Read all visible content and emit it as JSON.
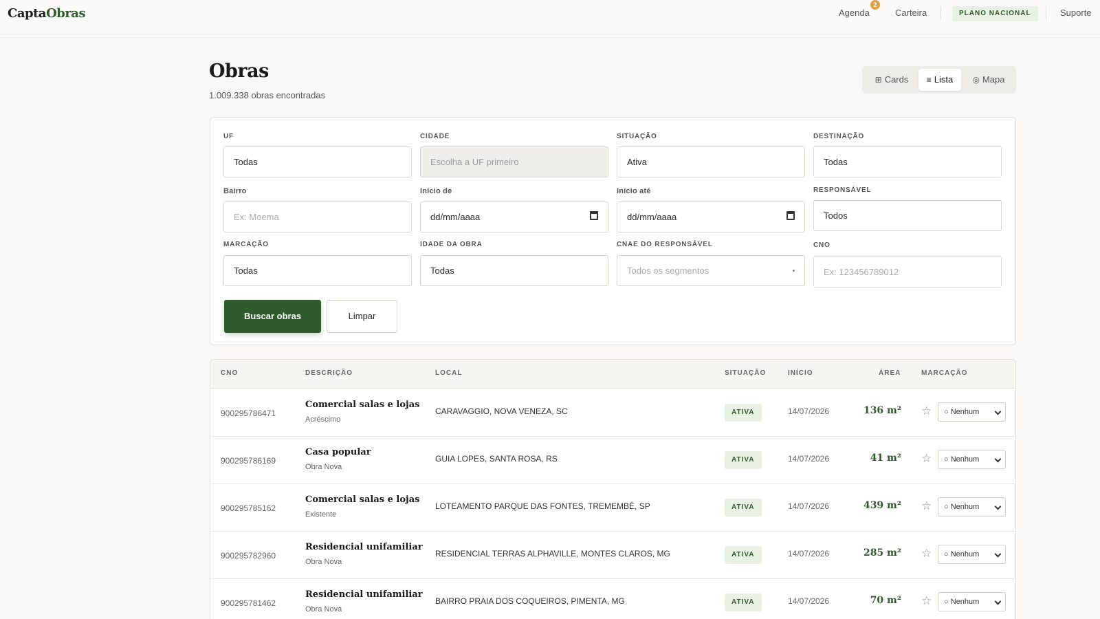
{
  "brand": {
    "part1": "Capta",
    "part2": "Obras",
    "accent_color": "#2f5a2b"
  },
  "nav": {
    "agenda": "Agenda",
    "agenda_badge": "2",
    "carteira": "Carteira",
    "plan": "PLANO NACIONAL",
    "suporte": "Suporte"
  },
  "page": {
    "title": "Obras",
    "subtitle": "1.009.338 obras encontradas"
  },
  "view_toggle": {
    "cards": "Cards",
    "lista": "Lista",
    "mapa": "Mapa",
    "cards_icon": "grid-icon",
    "lista_icon": "list-icon",
    "mapa_icon": "map-pin-icon",
    "active": "Lista"
  },
  "filters": {
    "uf": {
      "label": "UF",
      "value": "Todas"
    },
    "cidade": {
      "label": "CIDADE",
      "placeholder": "Escolha a UF primeiro"
    },
    "situacao": {
      "label": "SITUAÇÃO",
      "value": "Ativa"
    },
    "destinacao": {
      "label": "DESTINAÇÃO",
      "value": "Todas"
    },
    "bairro": {
      "label": "Bairro",
      "placeholder": "Ex: Moema"
    },
    "inicio_de": {
      "label": "Início de",
      "value": "dd/mm/aaaa"
    },
    "inicio_ate": {
      "label": "Início até",
      "value": "dd/mm/aaaa"
    },
    "responsavel": {
      "label": "RESPONSÁVEL",
      "value": "Todos"
    },
    "marcacao": {
      "label": "MARCAÇÃO",
      "value": "Todas"
    },
    "idade": {
      "label": "IDADE DA OBRA",
      "value": "Todas"
    },
    "cnae": {
      "label": "CNAE DO RESPONSÁVEL",
      "placeholder": "Todos os segmentos"
    },
    "cno": {
      "label": "CNO",
      "placeholder": "Ex: 123456789012"
    },
    "search_button": "Buscar obras",
    "clear_button": "Limpar"
  },
  "table": {
    "headers": {
      "cno": "CNO",
      "descricao": "DESCRIÇÃO",
      "local": "LOCAL",
      "situacao": "SITUAÇÃO",
      "inicio": "INÍCIO",
      "area": "ÁREA",
      "marcacao": "MARCAÇÃO"
    },
    "rows": [
      {
        "cno": "900295786471",
        "desc": "Comercial salas e lojas",
        "sub": "Acréscimo",
        "local": "CARAVAGGIO, NOVA VENEZA, SC",
        "status": "ATIVA",
        "date": "14/07/2026",
        "area": "136 m²",
        "mark": "○ Nenhum"
      },
      {
        "cno": "900295786169",
        "desc": "Casa popular",
        "sub": "Obra Nova",
        "local": "GUIA LOPES, SANTA ROSA, RS",
        "status": "ATIVA",
        "date": "14/07/2026",
        "area": "41 m²",
        "mark": "○ Nenhum"
      },
      {
        "cno": "900295785162",
        "desc": "Comercial salas e lojas",
        "sub": "Existente",
        "local": "LOTEAMENTO PARQUE DAS FONTES, TREMEMBÉ, SP",
        "status": "ATIVA",
        "date": "14/07/2026",
        "area": "439 m²",
        "mark": "○ Nenhum"
      },
      {
        "cno": "900295782960",
        "desc": "Residencial unifamiliar",
        "sub": "Obra Nova",
        "local": "RESIDENCIAL TERRAS ALPHAVILLE, MONTES CLAROS, MG",
        "status": "ATIVA",
        "date": "14/07/2026",
        "area": "285 m²",
        "mark": "○ Nenhum"
      },
      {
        "cno": "900295781462",
        "desc": "Residencial unifamiliar",
        "sub": "Obra Nova",
        "local": "BAIRRO PRAIA DOS COQUEIROS, PIMENTA, MG",
        "status": "ATIVA",
        "date": "14/07/2026",
        "area": "70 m²",
        "mark": "○ Nenhum"
      }
    ]
  }
}
